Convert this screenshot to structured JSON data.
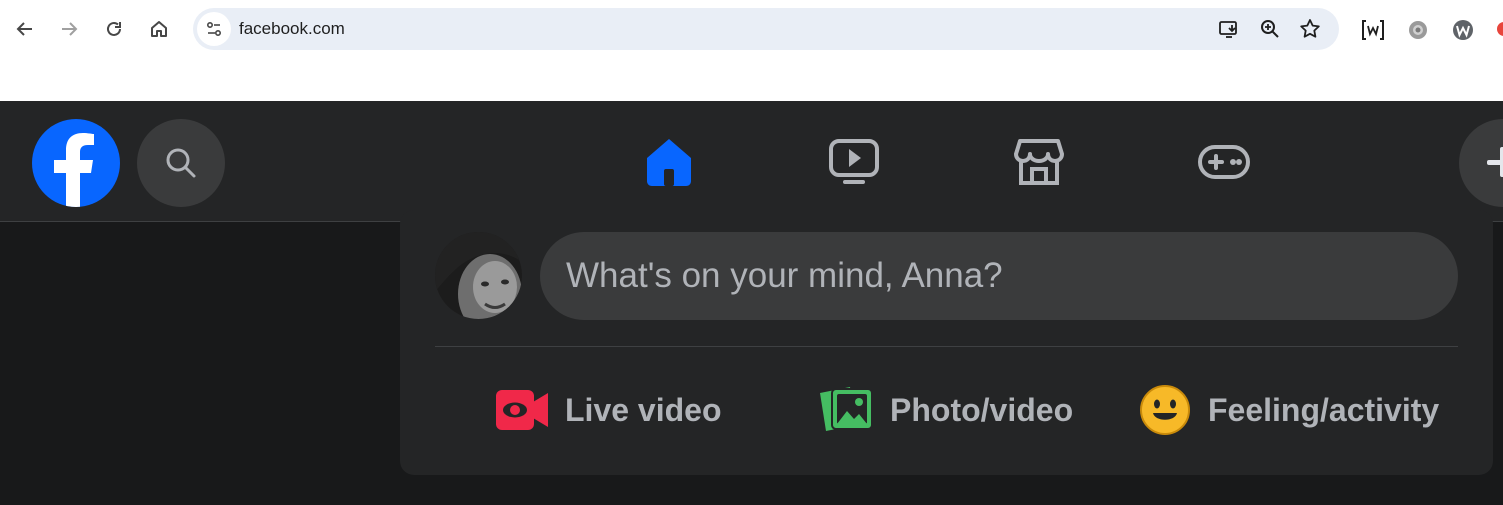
{
  "browser": {
    "url": "facebook.com",
    "nav": {
      "back": "back-arrow",
      "forward": "forward-arrow",
      "reload": "reload",
      "home": "home"
    },
    "omnibox_icons": [
      "install-app",
      "zoom",
      "bookmark-star"
    ],
    "extensions": [
      "extension-bracket-w",
      "extension-gear",
      "extension-w-circle"
    ]
  },
  "facebook": {
    "logo": "f",
    "tabs": [
      {
        "name": "home",
        "active": true
      },
      {
        "name": "watch",
        "active": false
      },
      {
        "name": "marketplace",
        "active": false
      },
      {
        "name": "gaming",
        "active": false
      }
    ],
    "colors": {
      "brand": "#0866ff",
      "bar_bg": "#242526",
      "page_bg": "#18191a"
    }
  },
  "composer": {
    "placeholder": "What's on your mind, Anna?",
    "actions": [
      {
        "label": "Live video",
        "icon": "live-video-icon",
        "color": "#f02849"
      },
      {
        "label": "Photo/video",
        "icon": "photo-video-icon",
        "color": "#45bd62"
      },
      {
        "label": "Feeling/activity",
        "icon": "feeling-activity-icon",
        "color": "#f7b928"
      }
    ]
  }
}
